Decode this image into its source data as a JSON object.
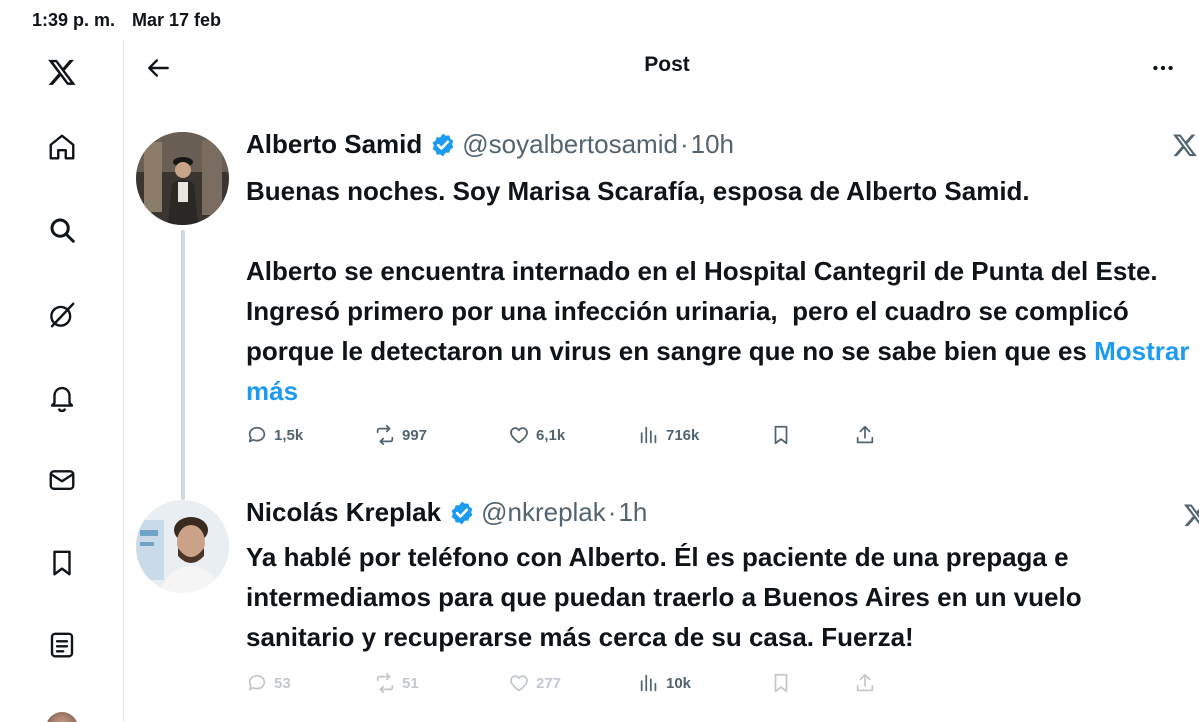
{
  "status_bar": {
    "time": "1:39 p. m.",
    "date": "Mar 17 feb"
  },
  "sidebar": {
    "items": [
      {
        "icon": "x-logo-icon"
      },
      {
        "icon": "home-icon"
      },
      {
        "icon": "search-icon"
      },
      {
        "icon": "grok-icon"
      },
      {
        "icon": "bell-icon"
      },
      {
        "icon": "mail-icon"
      },
      {
        "icon": "bookmark-icon"
      },
      {
        "icon": "list-icon"
      }
    ]
  },
  "header": {
    "title": "Post"
  },
  "tweets": [
    {
      "name": "Alberto Samid",
      "handle": "@soyalbertosamid",
      "separator": "·",
      "time": "10h",
      "paragraph1": "Buenas noches. Soy Marisa Scarafía, esposa de Alberto Samid.",
      "paragraph2": "Alberto se encuentra internado en el Hospital Cantegril de Punta del Este. Ingresó primero por una infección urinaria,  pero el cuadro se complicó porque le detectaron un virus en sangre que no se sabe bien que es ",
      "show_more": "Mostrar más",
      "replies": "1,5k",
      "reposts": "997",
      "likes": "6,1k",
      "views": "716k"
    },
    {
      "name": "Nicolás Kreplak",
      "handle": "@nkreplak",
      "separator": "·",
      "time": "1h",
      "text": "Ya hablé por teléfono con Alberto. Él es paciente de una prepaga e intermediamos para que puedan traerlo a Buenos Aires en un vuelo sanitario y recuperarse más cerca de su casa. Fuerza!",
      "replies": "53",
      "reposts": "51",
      "likes": "277",
      "views": "10k"
    }
  ],
  "colors": {
    "accent": "#1d9bf0",
    "text": "#0f1419",
    "muted": "#536471",
    "verified": "#1d9bf0"
  }
}
